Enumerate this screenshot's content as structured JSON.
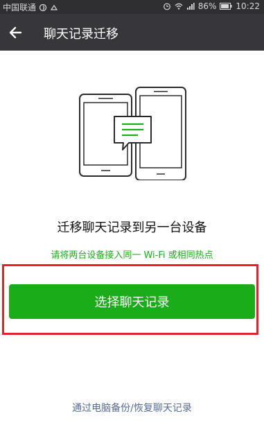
{
  "status_bar": {
    "carrier": "中国联通",
    "battery": "86%",
    "time": "10:22"
  },
  "title_bar": {
    "title": "聊天记录迁移"
  },
  "main": {
    "heading": "迁移聊天记录到另一台设备",
    "hint": "请将两台设备接入同一 Wi-Fi 或相同热点",
    "primary_button": "选择聊天记录",
    "footer_link": "通过电脑备份/恢复聊天记录"
  },
  "colors": {
    "accent_green": "#1aad19",
    "title_bar_bg": "#37373b",
    "highlight_red": "#e5202a",
    "link_blue": "#576b95"
  },
  "icons": [
    "back-arrow-icon",
    "wifi-icon",
    "signal-icon",
    "battery-icon",
    "alarm-icon",
    "phones-transfer-illustration"
  ]
}
